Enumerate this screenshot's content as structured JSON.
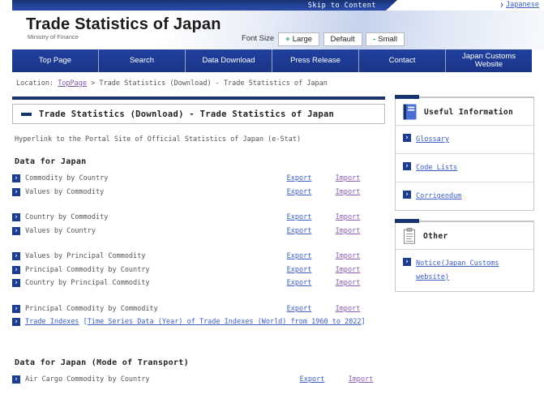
{
  "top_bar": {
    "skip_link": "Skip to Content",
    "language_link": "Japanese"
  },
  "header": {
    "title": "Trade Statistics of Japan",
    "subtitle": "Ministry of Finance",
    "font_size": {
      "label": "Font Size",
      "buttons": [
        {
          "sign": "+",
          "text": "Large"
        },
        {
          "sign": "",
          "text": "Default"
        },
        {
          "sign": "-",
          "text": "Small"
        }
      ]
    }
  },
  "nav": {
    "items": [
      "Top Page",
      "Search",
      "Data Download",
      "Press Release",
      "Contact",
      "Japan Customs Website"
    ]
  },
  "breadcrumb": {
    "prefix": "Location:",
    "home": "TopPage",
    "separator": ">",
    "current": "Trade Statistics (Download) - Trade Statistics of Japan"
  },
  "page": {
    "heading": "Trade Statistics (Download) - Trade Statistics of Japan",
    "intro": "Hyperlink to the Portal Site of Official Statistics of Japan (e-Stat)"
  },
  "links": {
    "export_label": "Export",
    "import_label": "Import"
  },
  "sections": [
    {
      "heading": "Data for Japan",
      "col_shift": false,
      "groups": [
        [
          {
            "label": "Commodity by Country"
          },
          {
            "label": "Values by Commodity"
          }
        ],
        [
          {
            "label": "Country by Commodity"
          },
          {
            "label": "Values by Country"
          }
        ],
        [
          {
            "label": "Values by Principal Commodity"
          },
          {
            "label": "Principal Commodity by Country"
          },
          {
            "label": "Country by Principal Commodity"
          }
        ],
        [
          {
            "label": "Principal Commodity by Commodity"
          },
          {
            "link1": "Trade Indexes",
            "bracket_open": "[",
            "link2": "Time Series Data (Year) of Trade Indexes (World) from 1960 to 2022",
            "bracket_close": "]"
          }
        ]
      ]
    },
    {
      "heading": "Data for Japan (Mode of Transport)",
      "col_shift": true,
      "groups": [
        [
          {
            "label": "Air Cargo Commodity by Country"
          }
        ]
      ]
    }
  ],
  "sidebar": {
    "boxes": [
      {
        "icon": "book-icon",
        "title": "Useful Information",
        "links": [
          "Glossary",
          "Code Lists",
          "Corrigendum"
        ]
      },
      {
        "icon": "clipboard-icon",
        "title": "Other",
        "links": [
          "Notice(Japan Customs website)"
        ]
      }
    ]
  },
  "colors": {
    "navy": "#17336e",
    "nav_blue": "#1e3c96",
    "link_blue": "#3c5ec5",
    "visited_purple": "#8a5fb5",
    "accent_green": "#1fa05a"
  }
}
